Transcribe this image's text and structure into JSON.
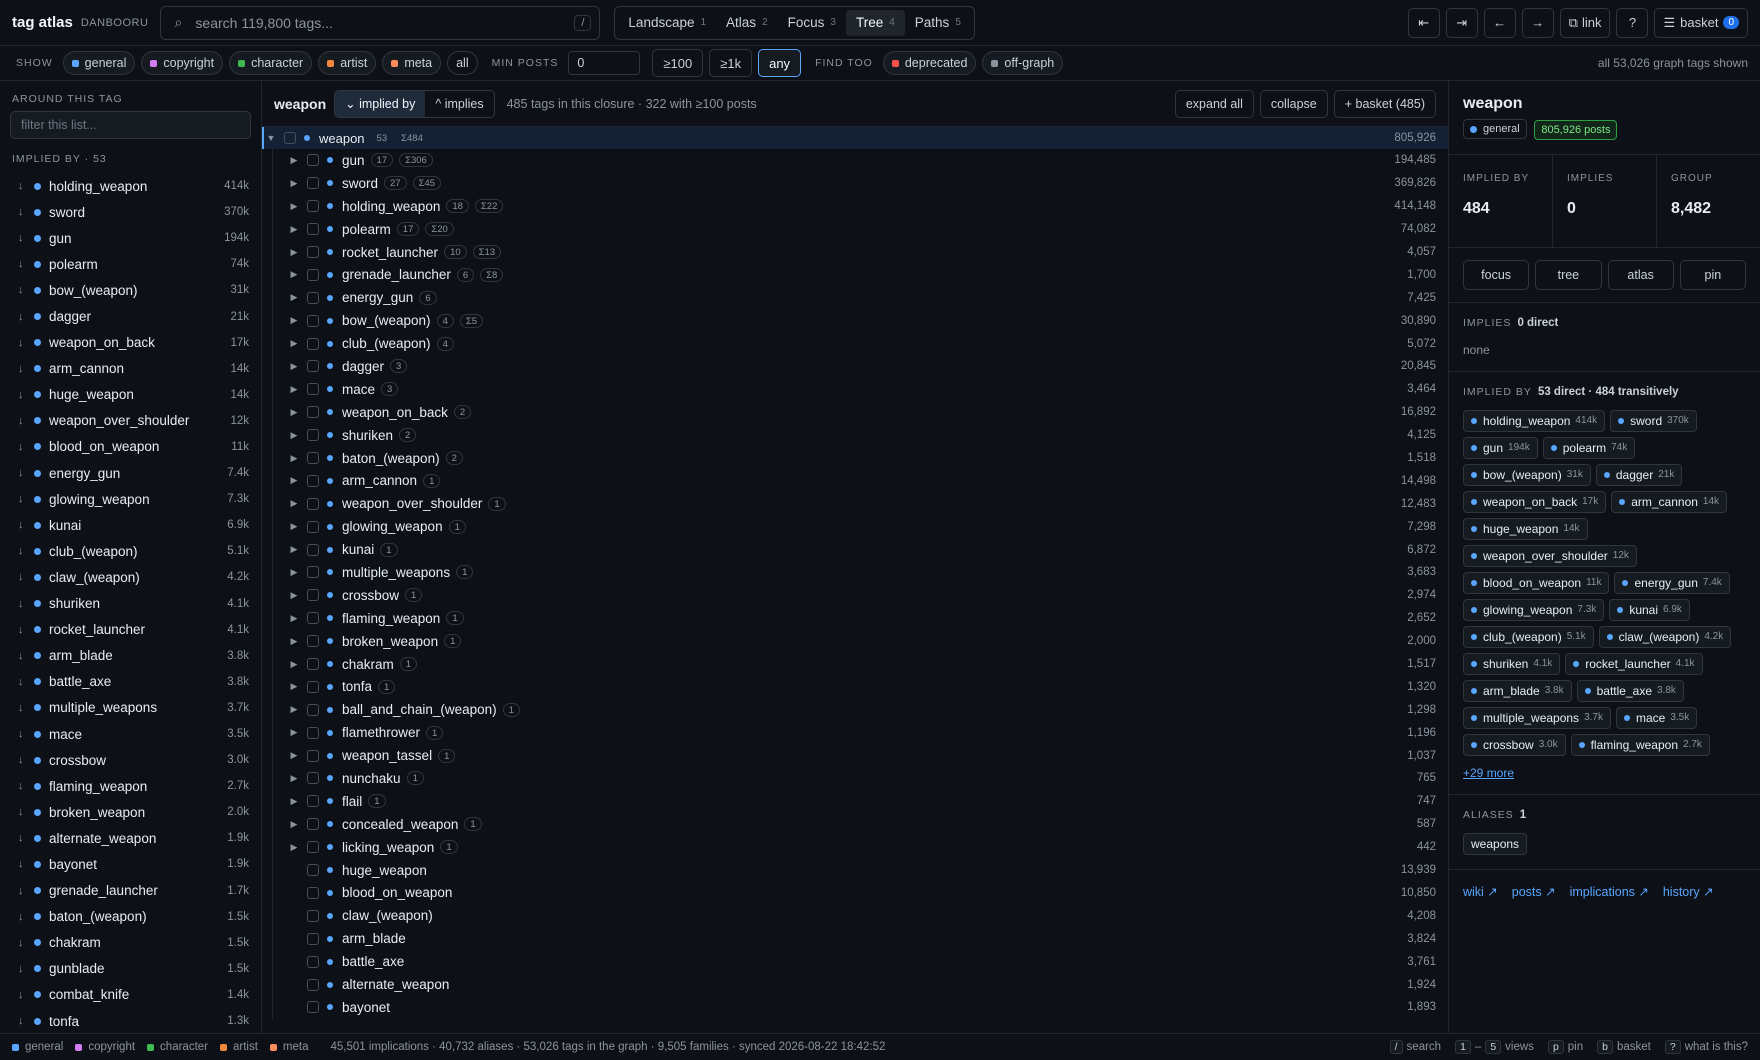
{
  "brand": {
    "name": "tag atlas",
    "sub": "DANBOORU"
  },
  "search": {
    "placeholder": "search 119,800 tags...",
    "kbd": "/"
  },
  "views": [
    {
      "label": "Landscape",
      "n": "1"
    },
    {
      "label": "Atlas",
      "n": "2"
    },
    {
      "label": "Focus",
      "n": "3"
    },
    {
      "label": "Tree",
      "n": "4",
      "active": true
    },
    {
      "label": "Paths",
      "n": "5"
    }
  ],
  "topright": {
    "first": "⇤",
    "last": "⇥",
    "back": "←",
    "forward": "→",
    "link": "link",
    "help": "?",
    "basket": "basket",
    "basket_count": "0"
  },
  "filterbar": {
    "show_label": "SHOW",
    "categories": [
      {
        "label": "general",
        "color": "#58a6ff"
      },
      {
        "label": "copyright",
        "color": "#d27df0"
      },
      {
        "label": "character",
        "color": "#3fb950"
      },
      {
        "label": "artist",
        "color": "#f0883e"
      },
      {
        "label": "meta",
        "color": "#ff8a5c"
      }
    ],
    "all_label": "all",
    "minposts_label": "MIN POSTS",
    "minposts_value": "0",
    "post_buttons": [
      "≥100",
      "≥1k",
      "any"
    ],
    "findtoo_label": "FIND TOO",
    "findtoo": [
      {
        "label": "deprecated",
        "color": "#f85149"
      },
      {
        "label": "off-graph",
        "color": "#8b949e"
      }
    ],
    "shown": "all 53,026 graph tags shown"
  },
  "left": {
    "section": "AROUND THIS TAG",
    "filter_placeholder": "filter this list...",
    "implied_label": "IMPLIED BY · 53",
    "items": [
      {
        "name": "holding_weapon",
        "count": "414k"
      },
      {
        "name": "sword",
        "count": "370k"
      },
      {
        "name": "gun",
        "count": "194k"
      },
      {
        "name": "polearm",
        "count": "74k"
      },
      {
        "name": "bow_(weapon)",
        "count": "31k"
      },
      {
        "name": "dagger",
        "count": "21k"
      },
      {
        "name": "weapon_on_back",
        "count": "17k"
      },
      {
        "name": "arm_cannon",
        "count": "14k"
      },
      {
        "name": "huge_weapon",
        "count": "14k"
      },
      {
        "name": "weapon_over_shoulder",
        "count": "12k"
      },
      {
        "name": "blood_on_weapon",
        "count": "11k"
      },
      {
        "name": "energy_gun",
        "count": "7.4k"
      },
      {
        "name": "glowing_weapon",
        "count": "7.3k"
      },
      {
        "name": "kunai",
        "count": "6.9k"
      },
      {
        "name": "club_(weapon)",
        "count": "5.1k"
      },
      {
        "name": "claw_(weapon)",
        "count": "4.2k"
      },
      {
        "name": "shuriken",
        "count": "4.1k"
      },
      {
        "name": "rocket_launcher",
        "count": "4.1k"
      },
      {
        "name": "arm_blade",
        "count": "3.8k"
      },
      {
        "name": "battle_axe",
        "count": "3.8k"
      },
      {
        "name": "multiple_weapons",
        "count": "3.7k"
      },
      {
        "name": "mace",
        "count": "3.5k"
      },
      {
        "name": "crossbow",
        "count": "3.0k"
      },
      {
        "name": "flaming_weapon",
        "count": "2.7k"
      },
      {
        "name": "broken_weapon",
        "count": "2.0k"
      },
      {
        "name": "alternate_weapon",
        "count": "1.9k"
      },
      {
        "name": "bayonet",
        "count": "1.9k"
      },
      {
        "name": "grenade_launcher",
        "count": "1.7k"
      },
      {
        "name": "baton_(weapon)",
        "count": "1.5k"
      },
      {
        "name": "chakram",
        "count": "1.5k"
      },
      {
        "name": "gunblade",
        "count": "1.5k"
      },
      {
        "name": "combat_knife",
        "count": "1.4k"
      },
      {
        "name": "tonfa",
        "count": "1.3k"
      }
    ]
  },
  "main": {
    "title": "weapon",
    "implied_by": "⌄ implied by",
    "implies": "^ implies",
    "closure": "485 tags in this closure · 322 with ≥100 posts",
    "expand": "expand all",
    "collapse": "collapse",
    "basket": "+ basket (485)",
    "root": {
      "name": "weapon",
      "n": "53",
      "sigma": "Σ484",
      "count": "805,926"
    },
    "rows": [
      {
        "name": "gun",
        "n": "17",
        "sigma": "Σ306",
        "count": "194,485",
        "exp": true
      },
      {
        "name": "sword",
        "n": "27",
        "sigma": "Σ45",
        "count": "369,826",
        "exp": true
      },
      {
        "name": "holding_weapon",
        "n": "18",
        "sigma": "Σ22",
        "count": "414,148",
        "exp": true
      },
      {
        "name": "polearm",
        "n": "17",
        "sigma": "Σ20",
        "count": "74,082",
        "exp": true
      },
      {
        "name": "rocket_launcher",
        "n": "10",
        "sigma": "Σ13",
        "count": "4,057",
        "exp": true
      },
      {
        "name": "grenade_launcher",
        "n": "6",
        "sigma": "Σ8",
        "count": "1,700",
        "exp": true
      },
      {
        "name": "energy_gun",
        "n": "6",
        "sigma": "",
        "count": "7,425",
        "exp": true
      },
      {
        "name": "bow_(weapon)",
        "n": "4",
        "sigma": "Σ5",
        "count": "30,890",
        "exp": true
      },
      {
        "name": "club_(weapon)",
        "n": "4",
        "sigma": "",
        "count": "5,072",
        "exp": true
      },
      {
        "name": "dagger",
        "n": "3",
        "sigma": "",
        "count": "20,845",
        "exp": true
      },
      {
        "name": "mace",
        "n": "3",
        "sigma": "",
        "count": "3,464",
        "exp": true
      },
      {
        "name": "weapon_on_back",
        "n": "2",
        "sigma": "",
        "count": "16,892",
        "exp": true
      },
      {
        "name": "shuriken",
        "n": "2",
        "sigma": "",
        "count": "4,125",
        "exp": true
      },
      {
        "name": "baton_(weapon)",
        "n": "2",
        "sigma": "",
        "count": "1,518",
        "exp": true
      },
      {
        "name": "arm_cannon",
        "n": "1",
        "sigma": "",
        "count": "14,498",
        "exp": true
      },
      {
        "name": "weapon_over_shoulder",
        "n": "1",
        "sigma": "",
        "count": "12,483",
        "exp": true
      },
      {
        "name": "glowing_weapon",
        "n": "1",
        "sigma": "",
        "count": "7,298",
        "exp": true
      },
      {
        "name": "kunai",
        "n": "1",
        "sigma": "",
        "count": "6,872",
        "exp": true
      },
      {
        "name": "multiple_weapons",
        "n": "1",
        "sigma": "",
        "count": "3,683",
        "exp": true
      },
      {
        "name": "crossbow",
        "n": "1",
        "sigma": "",
        "count": "2,974",
        "exp": true
      },
      {
        "name": "flaming_weapon",
        "n": "1",
        "sigma": "",
        "count": "2,652",
        "exp": true
      },
      {
        "name": "broken_weapon",
        "n": "1",
        "sigma": "",
        "count": "2,000",
        "exp": true
      },
      {
        "name": "chakram",
        "n": "1",
        "sigma": "",
        "count": "1,517",
        "exp": true
      },
      {
        "name": "tonfa",
        "n": "1",
        "sigma": "",
        "count": "1,320",
        "exp": true
      },
      {
        "name": "ball_and_chain_(weapon)",
        "n": "1",
        "sigma": "",
        "count": "1,298",
        "exp": true
      },
      {
        "name": "flamethrower",
        "n": "1",
        "sigma": "",
        "count": "1,196",
        "exp": true
      },
      {
        "name": "weapon_tassel",
        "n": "1",
        "sigma": "",
        "count": "1,037",
        "exp": true
      },
      {
        "name": "nunchaku",
        "n": "1",
        "sigma": "",
        "count": "765",
        "exp": true
      },
      {
        "name": "flail",
        "n": "1",
        "sigma": "",
        "count": "747",
        "exp": true
      },
      {
        "name": "concealed_weapon",
        "n": "1",
        "sigma": "",
        "count": "587",
        "exp": true
      },
      {
        "name": "licking_weapon",
        "n": "1",
        "sigma": "",
        "count": "442",
        "exp": true
      },
      {
        "name": "huge_weapon",
        "n": "",
        "sigma": "",
        "count": "13,939",
        "exp": false
      },
      {
        "name": "blood_on_weapon",
        "n": "",
        "sigma": "",
        "count": "10,850",
        "exp": false
      },
      {
        "name": "claw_(weapon)",
        "n": "",
        "sigma": "",
        "count": "4,208",
        "exp": false
      },
      {
        "name": "arm_blade",
        "n": "",
        "sigma": "",
        "count": "3,824",
        "exp": false
      },
      {
        "name": "battle_axe",
        "n": "",
        "sigma": "",
        "count": "3,761",
        "exp": false
      },
      {
        "name": "alternate_weapon",
        "n": "",
        "sigma": "",
        "count": "1,924",
        "exp": false
      },
      {
        "name": "bayonet",
        "n": "",
        "sigma": "",
        "count": "1,893",
        "exp": false
      }
    ]
  },
  "right": {
    "title": "weapon",
    "category": "general",
    "posts": "805,926 posts",
    "stats": [
      {
        "k": "IMPLIED BY",
        "v": "484"
      },
      {
        "k": "IMPLIES",
        "v": "0"
      },
      {
        "k": "GROUP",
        "v": "8,482"
      }
    ],
    "actions": [
      "focus",
      "tree",
      "atlas",
      "pin"
    ],
    "implies_head": "IMPLIES",
    "implies_direct": "0 direct",
    "implies_none": "none",
    "impliedby_head": "IMPLIED BY",
    "impliedby_sub": "53 direct · 484 transitively",
    "chips": [
      {
        "name": "holding_weapon",
        "c": "414k"
      },
      {
        "name": "sword",
        "c": "370k"
      },
      {
        "name": "gun",
        "c": "194k"
      },
      {
        "name": "polearm",
        "c": "74k"
      },
      {
        "name": "bow_(weapon)",
        "c": "31k"
      },
      {
        "name": "dagger",
        "c": "21k"
      },
      {
        "name": "weapon_on_back",
        "c": "17k"
      },
      {
        "name": "arm_cannon",
        "c": "14k"
      },
      {
        "name": "huge_weapon",
        "c": "14k"
      },
      {
        "name": "weapon_over_shoulder",
        "c": "12k"
      },
      {
        "name": "blood_on_weapon",
        "c": "11k"
      },
      {
        "name": "energy_gun",
        "c": "7.4k"
      },
      {
        "name": "glowing_weapon",
        "c": "7.3k"
      },
      {
        "name": "kunai",
        "c": "6.9k"
      },
      {
        "name": "club_(weapon)",
        "c": "5.1k"
      },
      {
        "name": "claw_(weapon)",
        "c": "4.2k"
      },
      {
        "name": "shuriken",
        "c": "4.1k"
      },
      {
        "name": "rocket_launcher",
        "c": "4.1k"
      },
      {
        "name": "arm_blade",
        "c": "3.8k"
      },
      {
        "name": "battle_axe",
        "c": "3.8k"
      },
      {
        "name": "multiple_weapons",
        "c": "3.7k"
      },
      {
        "name": "mace",
        "c": "3.5k"
      },
      {
        "name": "crossbow",
        "c": "3.0k"
      },
      {
        "name": "flaming_weapon",
        "c": "2.7k"
      }
    ],
    "more": "+29 more",
    "aliases_head": "ALIASES",
    "aliases_count": "1",
    "aliases": [
      "weapons"
    ],
    "links": [
      "wiki ↗",
      "posts ↗",
      "implications ↗",
      "history ↗"
    ]
  },
  "footer": {
    "legend": [
      {
        "label": "general",
        "color": "#58a6ff"
      },
      {
        "label": "copyright",
        "color": "#d27df0"
      },
      {
        "label": "character",
        "color": "#3fb950"
      },
      {
        "label": "artist",
        "color": "#f0883e"
      },
      {
        "label": "meta",
        "color": "#ff8a5c"
      }
    ],
    "status": "45,501 implications · 40,732 aliases · 53,026 tags in the graph · 9,505 families · synced 2026-08-22 18:42:52",
    "shortcuts": [
      {
        "keys": [
          "/"
        ],
        "label": "search"
      },
      {
        "keys": [
          "1",
          "5"
        ],
        "label": "views"
      },
      {
        "keys": [
          "p"
        ],
        "label": "pin"
      },
      {
        "keys": [
          "b"
        ],
        "label": "basket"
      },
      {
        "keys": [
          "?"
        ],
        "label": "what is this?"
      }
    ]
  }
}
